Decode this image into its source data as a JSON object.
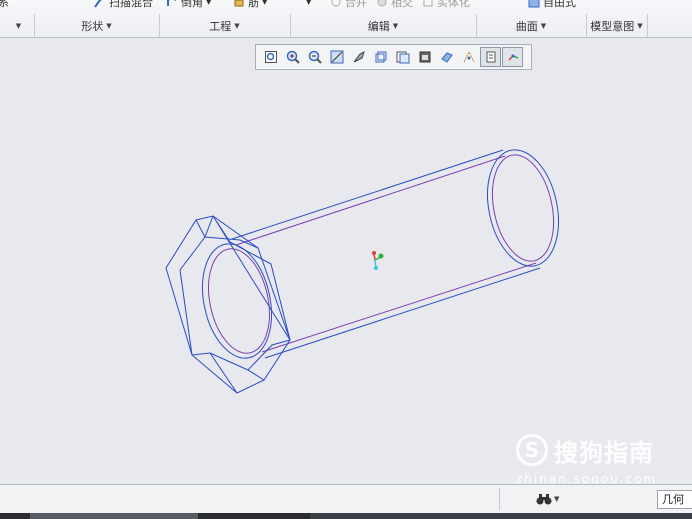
{
  "ribbon": {
    "top_items": [
      {
        "id": "sweep-item",
        "label": "系",
        "icon": "sweep-icon",
        "disabled": false
      },
      {
        "id": "swept-blend",
        "label": "扫描混合",
        "icon": "swept-blend-icon",
        "disabled": false
      },
      {
        "id": "round",
        "label": "倒角",
        "icon": "chamfer-icon",
        "disabled": false
      },
      {
        "id": "rib",
        "label": "筋",
        "icon": "rib-icon",
        "disabled": false
      },
      {
        "id": "edit-more",
        "label": "",
        "icon": "chevron-down-icon",
        "disabled": false
      },
      {
        "id": "merge",
        "label": "合并",
        "icon": "merge-icon",
        "disabled": true
      },
      {
        "id": "intersect",
        "label": "相交",
        "icon": "intersect-icon",
        "disabled": true
      },
      {
        "id": "solidify",
        "label": "实体化",
        "icon": "solidify-icon",
        "disabled": true
      },
      {
        "id": "freestyle",
        "label": "自由式",
        "icon": "freestyle-icon",
        "disabled": false
      }
    ],
    "groups": [
      {
        "id": "group-left",
        "label": ""
      },
      {
        "id": "group-shapes",
        "label": "形状"
      },
      {
        "id": "group-engineering",
        "label": "工程"
      },
      {
        "id": "group-editing",
        "label": "编辑"
      },
      {
        "id": "group-surfaces",
        "label": "曲面"
      },
      {
        "id": "group-model-intent",
        "label": "模型意图"
      }
    ]
  },
  "view_toolbar": {
    "buttons": [
      {
        "id": "refit",
        "icon": "refit-icon",
        "active": false
      },
      {
        "id": "zoom-in",
        "icon": "zoom-in-icon",
        "active": false
      },
      {
        "id": "zoom-out",
        "icon": "zoom-out-icon",
        "active": false
      },
      {
        "id": "repaint",
        "icon": "repaint-icon",
        "active": false
      },
      {
        "id": "display-style",
        "icon": "display-style-icon",
        "active": false
      },
      {
        "id": "saved-orientations",
        "icon": "saved-orientations-icon",
        "active": false
      },
      {
        "id": "view-manager",
        "icon": "view-manager-icon",
        "active": false
      },
      {
        "id": "perspective",
        "icon": "perspective-view-icon",
        "active": false
      },
      {
        "id": "section",
        "icon": "section-icon",
        "active": false
      },
      {
        "id": "datum-display",
        "icon": "datum-display-icon",
        "active": false
      },
      {
        "id": "annotation-display",
        "icon": "annotation-display-icon",
        "active": true
      },
      {
        "id": "spin-center",
        "icon": "spin-center-icon",
        "active": true
      }
    ]
  },
  "model": {
    "type": "wireframe hex-head tube",
    "edge_color": "#2c4bc6",
    "inner_edge_color": "#7c3fb0"
  },
  "watermark": {
    "brand": "搜狗指南",
    "url": "zhinan.sogou.com"
  },
  "statusbar": {
    "find_icon": "binoculars-icon",
    "filter_value": "几何"
  },
  "colors": {
    "background": "#e7e9ee",
    "wire_blue": "#2c4bc6",
    "wire_purple": "#7c3fb0"
  }
}
